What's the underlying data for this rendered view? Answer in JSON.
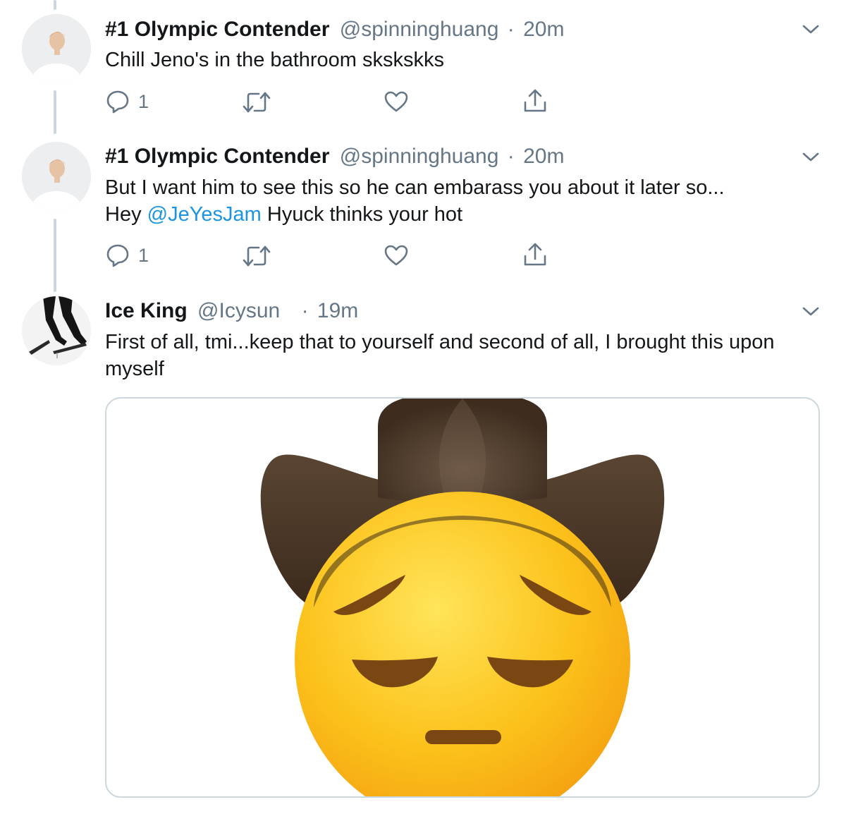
{
  "tweets": [
    {
      "name": "#1 Olympic Contender",
      "handle": "@spinninghuang",
      "separator": "·",
      "time": "20m",
      "text": "Chill Jeno's in the bathroom skskskks",
      "reply_count": "1"
    },
    {
      "name": "#1 Olympic Contender",
      "handle": "@spinninghuang",
      "separator": "·",
      "time": "20m",
      "text_line1": "But I want him to see this so he can embarass you about it later so...",
      "text_line2_prefix": "Hey ",
      "mention": "@JeYesJam",
      "text_line2_suffix": " Hyuck thinks your hot",
      "reply_count": "1"
    },
    {
      "name": "Ice King",
      "handle": "@Icysun",
      "separator": "·",
      "time": "19m",
      "text": "First of all, tmi...keep that to yourself and second of all, I brought this upon myself"
    }
  ],
  "icons": {
    "reply": "reply-icon",
    "retweet": "retweet-icon",
    "like": "heart-icon",
    "share": "share-icon",
    "menu": "chevron-down-icon"
  },
  "colors": {
    "link": "#1b95e0",
    "secondary_text": "#657786",
    "thread_line": "#ccd6dd"
  }
}
